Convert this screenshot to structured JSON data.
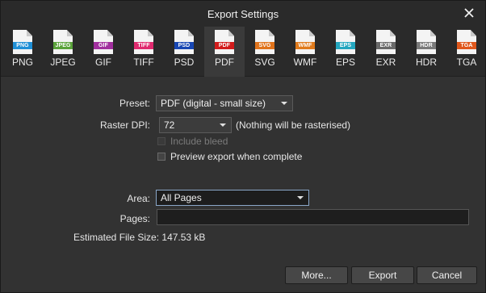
{
  "window": {
    "title": "Export Settings"
  },
  "formats": [
    {
      "label": "PNG",
      "band": "PNG",
      "color": "#1f8fd6"
    },
    {
      "label": "JPEG",
      "band": "JPEG",
      "color": "#5aa23a"
    },
    {
      "label": "GIF",
      "band": "GIF",
      "color": "#a12f9e"
    },
    {
      "label": "TIFF",
      "band": "TIFF",
      "color": "#e02a6f"
    },
    {
      "label": "PSD",
      "band": "PSD",
      "color": "#1847b3"
    },
    {
      "label": "PDF",
      "band": "PDF",
      "color": "#d21c1c"
    },
    {
      "label": "SVG",
      "band": "SVG",
      "color": "#e0731b"
    },
    {
      "label": "WMF",
      "band": "WMF",
      "color": "#e07a1b"
    },
    {
      "label": "EPS",
      "band": "EPS",
      "color": "#23a6bf"
    },
    {
      "label": "EXR",
      "band": "EXR",
      "color": "#6a6a6a"
    },
    {
      "label": "HDR",
      "band": "HDR",
      "color": "#7a7a7a"
    },
    {
      "label": "TGA",
      "band": "TGA",
      "color": "#e0571b"
    }
  ],
  "active_format": "PDF",
  "form": {
    "preset_label": "Preset:",
    "preset_value": "PDF (digital - small size)",
    "raster_dpi_label": "Raster DPI:",
    "raster_dpi_value": "72",
    "raster_note": "(Nothing will be rasterised)",
    "include_bleed": "Include bleed",
    "preview_export": "Preview export when complete",
    "area_label": "Area:",
    "area_value": "All Pages",
    "pages_label": "Pages:",
    "pages_value": "",
    "estimated_label": "Estimated File Size:",
    "estimated_value": "147.53 kB"
  },
  "buttons": {
    "more": "More...",
    "export": "Export",
    "cancel": "Cancel"
  }
}
